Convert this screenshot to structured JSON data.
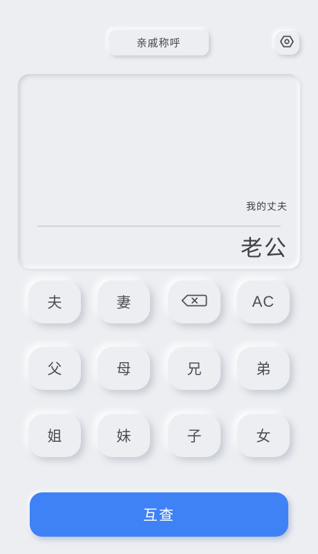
{
  "header": {
    "title": "亲戚称呼"
  },
  "display": {
    "expression": "我的丈夫",
    "result": "老公"
  },
  "keypad": {
    "rows": [
      [
        "夫",
        "妻",
        "",
        "AC"
      ],
      [
        "父",
        "母",
        "兄",
        "弟"
      ],
      [
        "姐",
        "妹",
        "子",
        "女"
      ]
    ]
  },
  "actions": {
    "query_label": "互查"
  },
  "icons": {
    "settings": "hexagon-settings-icon",
    "backspace": "backspace-icon"
  },
  "colors": {
    "background": "#eceef2",
    "primary": "#3f82f6",
    "text": "#44474d"
  }
}
